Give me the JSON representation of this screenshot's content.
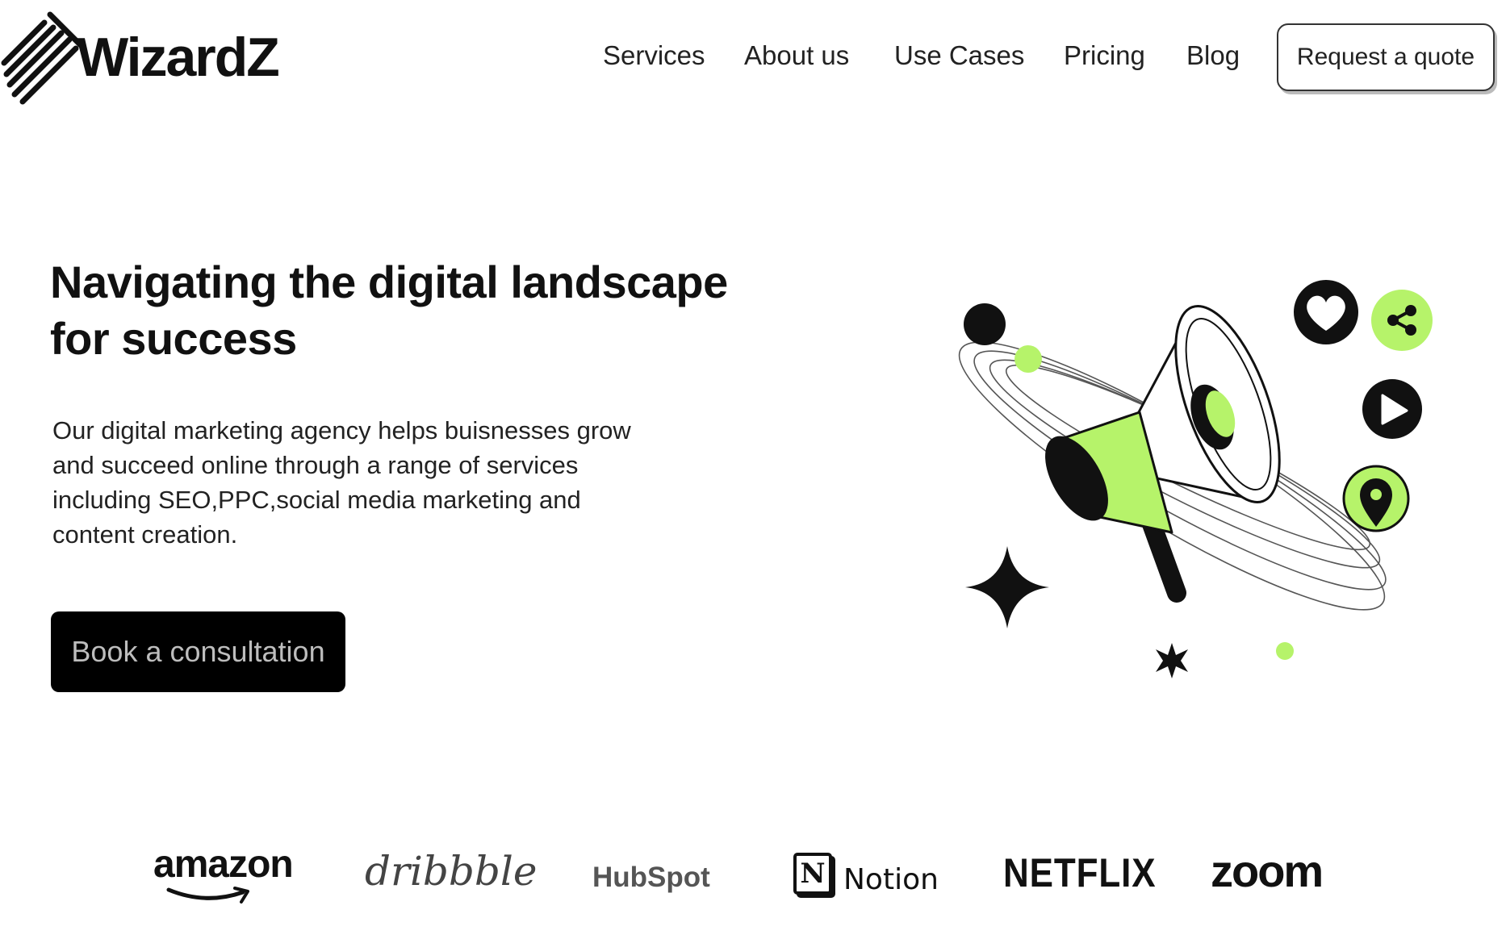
{
  "header": {
    "logo_text": "WizardZ",
    "nav": [
      "Services",
      "About us",
      "Use Cases",
      "Pricing",
      "Blog"
    ],
    "cta_label": "Request a quote"
  },
  "hero": {
    "title_lines": [
      "Navigating the digital landscape",
      "for success"
    ],
    "description_lines": [
      "Our digital marketing agency helps buisnesses grow",
      "and succeed online through a range of services",
      "including SEO,PPC,social media marketing and",
      "content creation."
    ],
    "button_label": "Book a consultation",
    "illustration_icons": [
      "megaphone-icon",
      "heart-icon",
      "share-icon",
      "play-icon",
      "location-pin-icon",
      "sparkle-star-icon"
    ]
  },
  "brands": [
    "amazon",
    "dribbble",
    "HubSpot",
    "Notion",
    "NETFLIX",
    "zoom"
  ],
  "colors": {
    "accent": "#b6f36a",
    "text": "#111111",
    "button_bg": "#000000",
    "button_text": "#bdbdbd"
  }
}
